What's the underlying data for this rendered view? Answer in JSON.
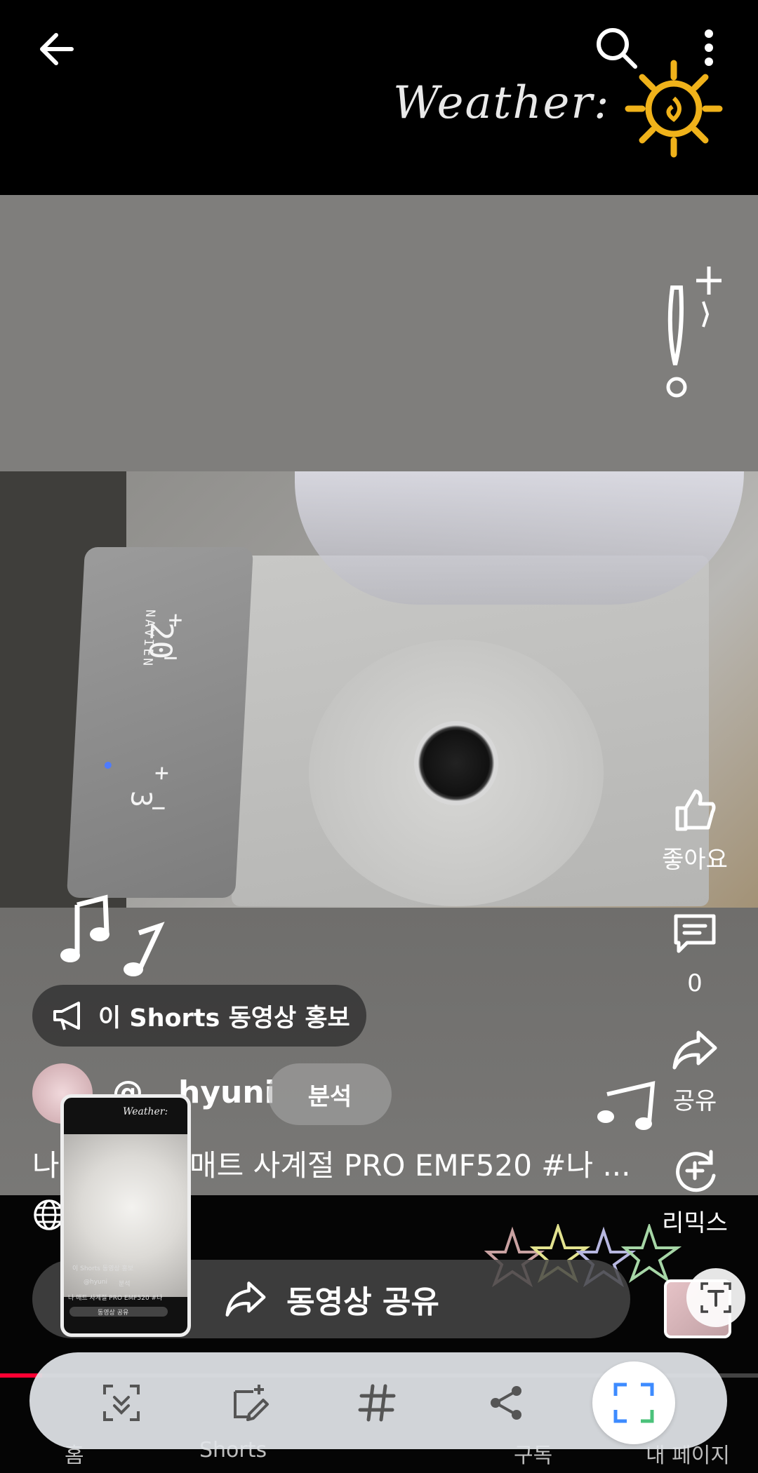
{
  "header": {
    "back_icon": "arrow-left-icon",
    "search_icon": "search-icon",
    "more_icon": "more-vertical-icon",
    "sticker_text": "Weather:"
  },
  "video": {
    "panel_display": {
      "top_number": "20",
      "bottom_number": "3",
      "brand": "NAVIEN"
    }
  },
  "actions": {
    "like_label": "좋아요",
    "comment_count": "0",
    "share_label": "공유",
    "remix_label": "리믹스"
  },
  "promo": {
    "label": "이 Shorts 동영상 홍보"
  },
  "channel": {
    "handle_visible_left": "@",
    "handle_visible_right": "hyuni",
    "analysis_label": "분석"
  },
  "title": {
    "text_left": "나",
    "text_right": "매트 사계절 PRO EMF520 #나 ..."
  },
  "share_bar": {
    "label": "동영상 공유"
  },
  "bottom_nav": {
    "home_label": "홈",
    "shorts_label": "Shorts",
    "subs_label": "구독",
    "mypage_label": "내 페이지"
  },
  "thumbnail": {
    "weather_text": "Weather:",
    "promo_text": "이 Shorts 동영상 홍보",
    "share_text": "동영상 공유",
    "title_text": "나 매트 사계절 PRO EMF520 #나",
    "handle_text": "@hyuni",
    "analysis_text": "분석"
  },
  "toolbar": {
    "tools": [
      "scroll-capture-icon",
      "edit-crop-icon",
      "hashtag-icon",
      "share-icon",
      "smart-select-icon"
    ]
  },
  "colors": {
    "accent_red": "#ff0033",
    "toolbar_bg": "#e1e4e8",
    "active_tool": "#3d8bff"
  }
}
